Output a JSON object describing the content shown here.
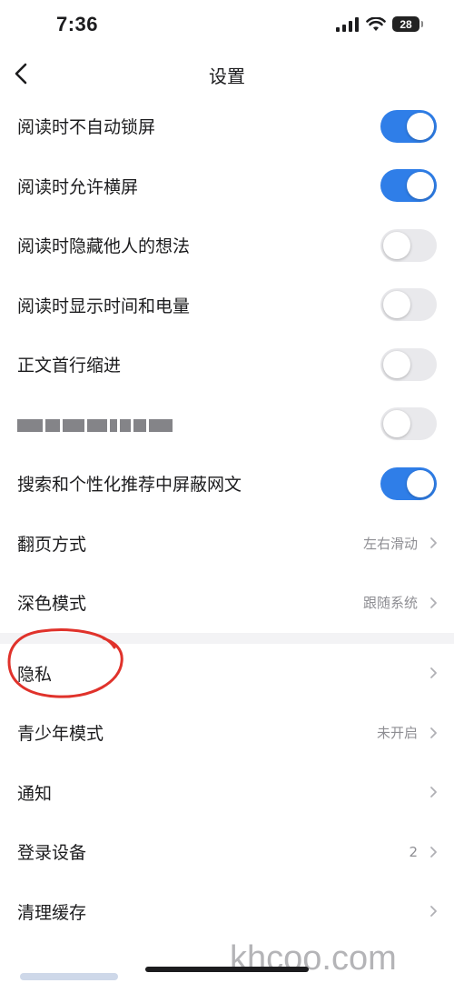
{
  "status_bar": {
    "time": "7:36",
    "battery": "28"
  },
  "nav": {
    "title": "设置"
  },
  "settings": [
    {
      "label": "阅读时不自动锁屏",
      "type": "toggle",
      "on": true
    },
    {
      "label": "阅读时允许横屏",
      "type": "toggle",
      "on": true
    },
    {
      "label": "阅读时隐藏他人的想法",
      "type": "toggle",
      "on": false
    },
    {
      "label": "阅读时显示时间和电量",
      "type": "toggle",
      "on": false
    },
    {
      "label": "正文首行缩进",
      "type": "toggle",
      "on": false
    },
    {
      "label": "",
      "type": "toggle",
      "on": false,
      "label_obscured": true
    },
    {
      "label": "搜索和个性化推荐中屏蔽网文",
      "type": "toggle",
      "on": true
    },
    {
      "label": "翻页方式",
      "type": "link",
      "value": "左右滑动"
    },
    {
      "label": "深色模式",
      "type": "link",
      "value": "跟随系统"
    }
  ],
  "settings2": [
    {
      "label": "隐私",
      "type": "link",
      "value": ""
    },
    {
      "label": "青少年模式",
      "type": "link",
      "value": "未开启"
    },
    {
      "label": "通知",
      "type": "link",
      "value": ""
    },
    {
      "label": "登录设备",
      "type": "link",
      "value": "2"
    },
    {
      "label": "清理缓存",
      "type": "link",
      "value": ""
    }
  ],
  "watermark": "khcoo.com",
  "colors": {
    "toggle_on": "#2f7ee8",
    "toggle_off": "#e9e9ec",
    "annotation": "#e0322b"
  }
}
